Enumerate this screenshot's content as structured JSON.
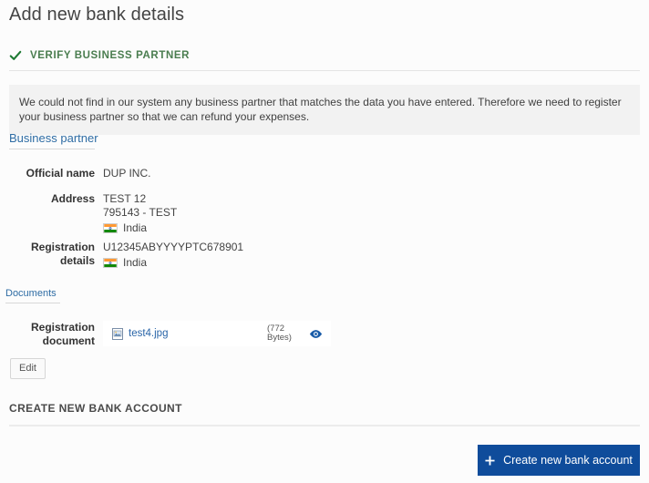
{
  "page": {
    "title": "Add new bank details"
  },
  "step": {
    "icon": "check-icon",
    "label": "VERIFY BUSINESS PARTNER"
  },
  "banner": {
    "text": "We could not find in our system any business partner that matches the data you have entered. Therefore we need to register your business partner so that we can refund your expenses."
  },
  "tabs": {
    "business_partner": "Business partner",
    "documents": "Documents"
  },
  "business_partner": {
    "fields": [
      {
        "label": "Official name",
        "value": "DUP INC."
      },
      {
        "label": "Address",
        "line1": "TEST 12",
        "line2": "795143 - TEST",
        "country": "India",
        "country_flag": "flag-india-icon"
      },
      {
        "label": "Registration details",
        "label_line1": "Registration",
        "label_line2": "details",
        "value": "U12345ABYYYYPTC678901",
        "country": "India",
        "country_flag": "flag-india-icon"
      }
    ]
  },
  "documents": {
    "label_line1": "Registration",
    "label_line2": "document",
    "file_name": "test4.jpg",
    "file_icon": "image-file-icon",
    "file_size_line1": "(772",
    "file_size_line2": "Bytes)",
    "preview_icon": "eye-icon",
    "edit_label": "Edit"
  },
  "bottom": {
    "section_title": "CREATE NEW BANK ACCOUNT",
    "cta_label": "Create new bank account",
    "cta_icon": "plus-icon"
  },
  "colors": {
    "step_green": "#4a7d4f",
    "check_green": "#1e7a33",
    "link_blue": "#2e6ca4",
    "cta_blue": "#0f4c9b",
    "banner_grey": "#f2f2f2"
  }
}
